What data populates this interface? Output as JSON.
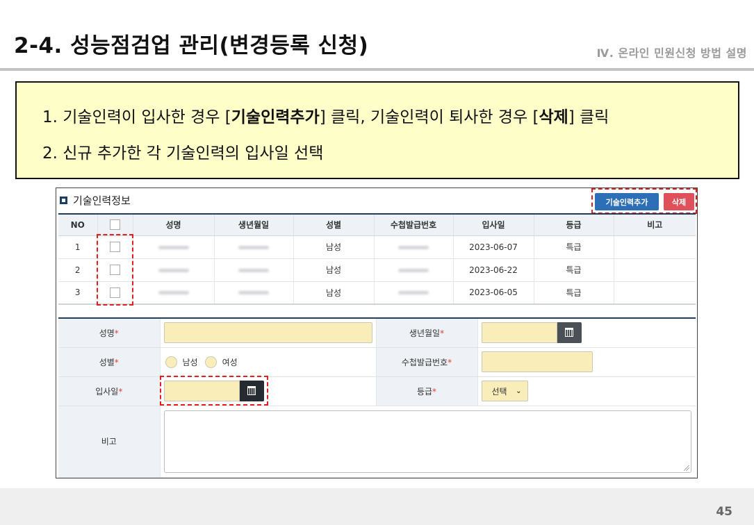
{
  "header": {
    "title": "2-4. 성능점검업 관리(변경등록 신청)",
    "chapter": "Ⅳ. 온라인 민원신청 방법 설명"
  },
  "instructions": {
    "line1": {
      "prefix": "1. 기술인력이 입사한 경우 [",
      "bold1": "기술인력추가",
      "middle": "] 클릭, 기술인력이 퇴사한 경우 [",
      "bold2": "삭제",
      "suffix": "] 클릭"
    },
    "line2": "2. 신규 추가한 각 기술인력의 입사일 선택"
  },
  "panel": {
    "section_title": "기술인력정보",
    "section_icon": "square-bullet-icon",
    "add_button": "기술인력추가",
    "delete_button": "삭제",
    "columns": [
      "NO",
      "",
      "성명",
      "생년월일",
      "성별",
      "수첩발급번호",
      "입사일",
      "등급",
      "비고"
    ],
    "rows": [
      {
        "no": "1",
        "gender": "남성",
        "join_date": "2023-06-07",
        "grade": "특급",
        "note": ""
      },
      {
        "no": "2",
        "gender": "남성",
        "join_date": "2023-06-22",
        "grade": "특급",
        "note": ""
      },
      {
        "no": "3",
        "gender": "남성",
        "join_date": "2023-06-05",
        "grade": "특급",
        "note": ""
      }
    ],
    "form": {
      "name_label": "성명",
      "birth_label": "생년월일",
      "gender_label": "성별",
      "gender_options": [
        "남성",
        "여성"
      ],
      "license_label": "수첩발급번호",
      "join_label": "입사일",
      "grade_label": "등급",
      "grade_value": "선택",
      "note_label": "비고",
      "required_mark": "*"
    }
  },
  "footer": {
    "page_number": "45"
  },
  "colors": {
    "instruction_bg": "#fefec8",
    "input_bg": "#f9eeb9",
    "add_button": "#2d6fb7",
    "delete_button": "#e0505a",
    "highlight_dash": "#e01f1f",
    "header_rule": "#1f3d5e"
  }
}
